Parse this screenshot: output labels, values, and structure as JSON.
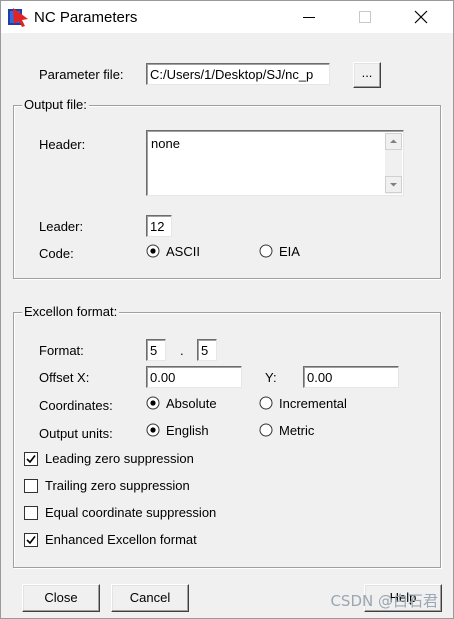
{
  "window": {
    "title": "NC Parameters"
  },
  "parameter_file": {
    "label": "Parameter file:",
    "value": "C:/Users/1/Desktop/SJ/nc_p",
    "browse_label": "..."
  },
  "output_file": {
    "group_title": "Output file:",
    "header_label": "Header:",
    "header_value": "none",
    "leader_label": "Leader:",
    "leader_value": "12",
    "code_label": "Code:",
    "code_options": [
      "ASCII",
      "EIA"
    ],
    "code_selected": "ASCII"
  },
  "excellon": {
    "group_title": "Excellon format:",
    "format_label": "Format:",
    "format_integer": "5",
    "format_sep": ".",
    "format_decimal": "5",
    "offset_x_label": "Offset X:",
    "offset_x_value": "0.00",
    "y_label": "Y:",
    "offset_y_value": "0.00",
    "coordinates_label": "Coordinates:",
    "coordinates_options": [
      "Absolute",
      "Incremental"
    ],
    "coordinates_selected": "Absolute",
    "units_label": "Output units:",
    "units_options": [
      "English",
      "Metric"
    ],
    "units_selected": "English",
    "checkboxes": [
      {
        "label": "Leading zero suppression",
        "checked": true
      },
      {
        "label": "Trailing zero suppression",
        "checked": false
      },
      {
        "label": "Equal coordinate suppression",
        "checked": false
      },
      {
        "label": "Enhanced Excellon format",
        "checked": true
      }
    ]
  },
  "buttons": {
    "close": "Close",
    "cancel": "Cancel",
    "help": "Help"
  },
  "watermark": "CSDN @白石君",
  "colors": {
    "titlebar_bg": "#ffffff",
    "dialog_bg": "#f0f0f0",
    "input_bg": "#ffffff",
    "groupbox_border": "#a0a0a0"
  }
}
